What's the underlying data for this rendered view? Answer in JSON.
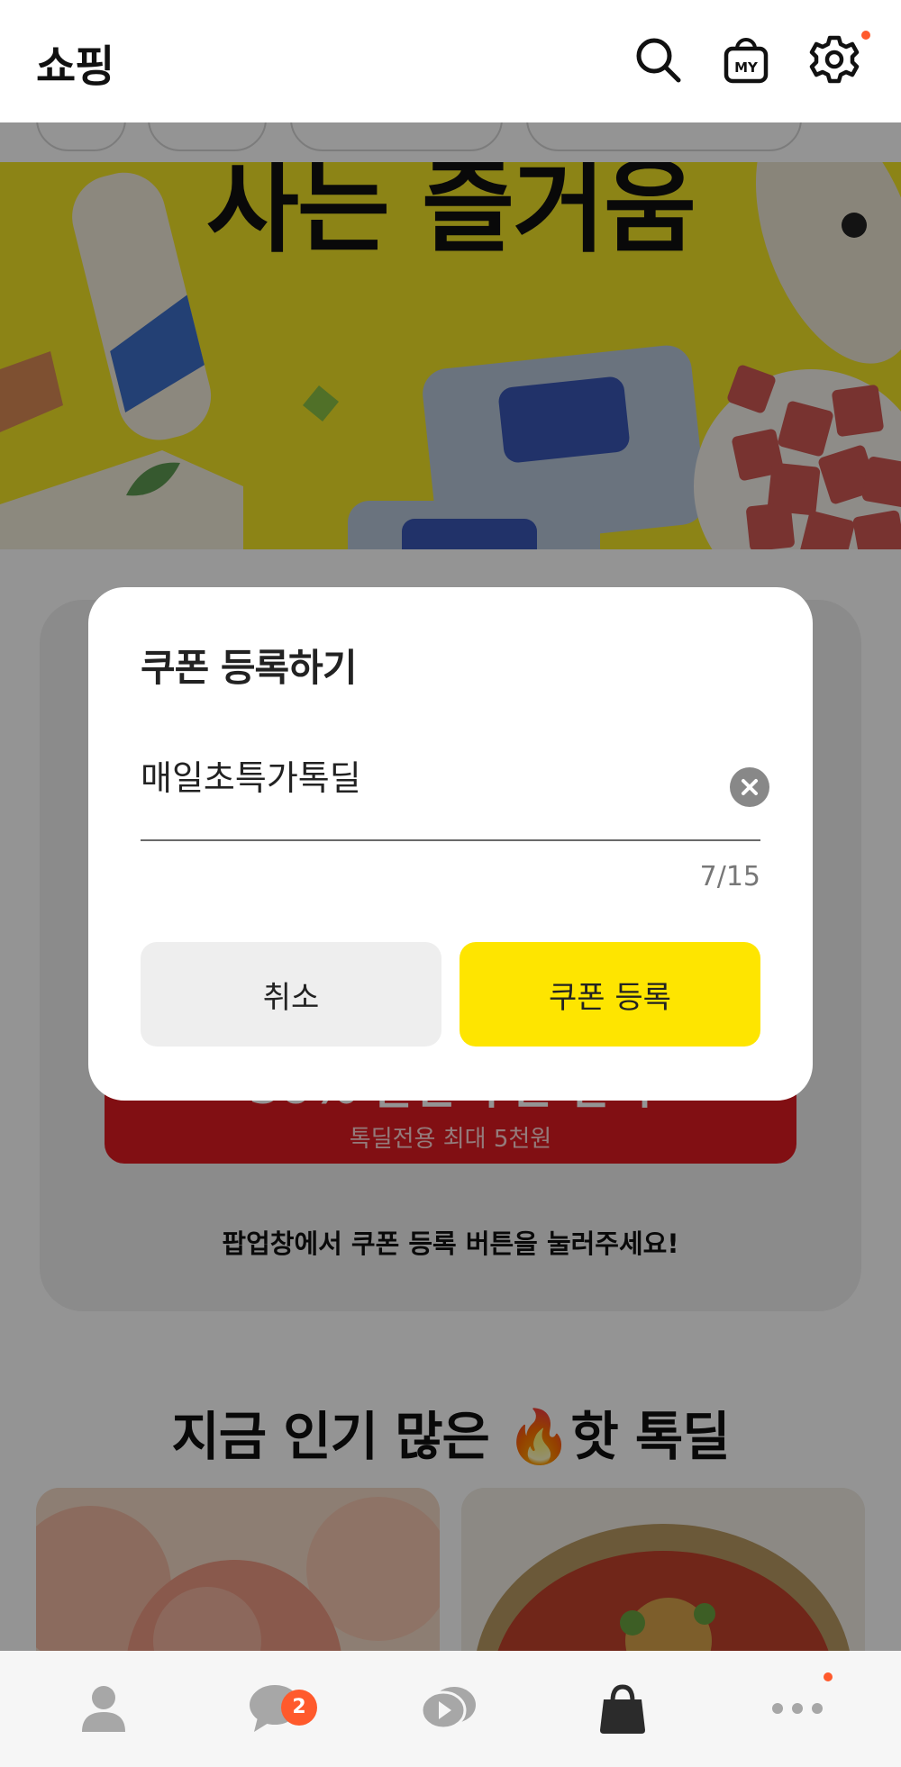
{
  "header": {
    "title": "쇼핑"
  },
  "banner": {
    "headline": "사는 즐거움"
  },
  "coupon_promo": {
    "button_main": "50% 할인 쿠폰 받기",
    "button_sub": "톡딜전용 최대 5천원",
    "hint": "팝업창에서 쿠폰 등록 버튼을 눌러주세요!"
  },
  "hot_deals": {
    "title_prefix": "지금 인기 많은 ",
    "title_suffix": "핫 톡딜",
    "emoji": "🔥"
  },
  "modal": {
    "title": "쿠폰 등록하기",
    "input_value": "매일초특가톡딜",
    "char_count": "7/15",
    "cancel_label": "취소",
    "confirm_label": "쿠폰 등록"
  },
  "bottom_nav": {
    "chat_badge": "2"
  },
  "colors": {
    "accent_yellow": "#fee500",
    "banner_yellow": "#f1e327",
    "coupon_red": "#de1a22",
    "notification_orange": "#ff5a2c"
  }
}
